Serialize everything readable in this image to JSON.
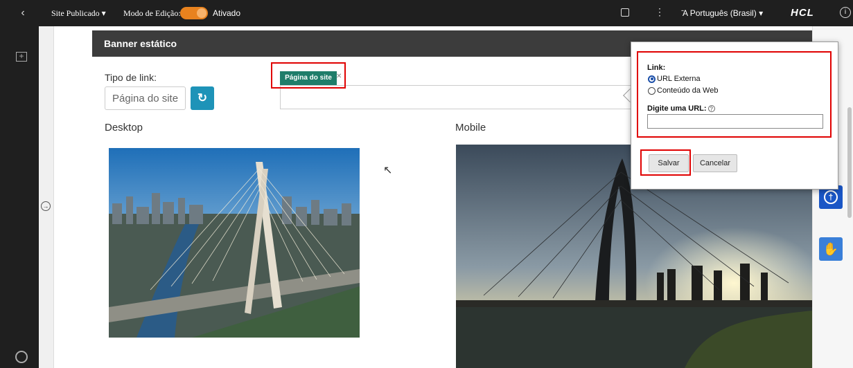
{
  "topbar": {
    "back_icon": "chevron-left-icon",
    "site_status": "Site Publicado",
    "edit_mode_label": "Modo de Edição:",
    "edit_mode_state": "Ativado",
    "language": "Português (Brasil)",
    "brand": "HCL"
  },
  "card": {
    "title": "Banner estático",
    "link_type_label": "Tipo de link:",
    "link_type_value": "Página do site",
    "selected_tag": "Página do site",
    "desktop_label": "Desktop",
    "mobile_label": "Mobile"
  },
  "popup": {
    "link_label": "Link:",
    "options": [
      "URL Externa",
      "Conteúdo da Web"
    ],
    "selected_option": "URL Externa",
    "url_label": "Digite uma URL:",
    "url_value": "",
    "save_label": "Salvar",
    "cancel_label": "Cancelar"
  },
  "colors": {
    "highlight": "#e00000",
    "toggle": "#e8821e",
    "accent": "#1e93b8",
    "tag": "#1f7d6a"
  }
}
